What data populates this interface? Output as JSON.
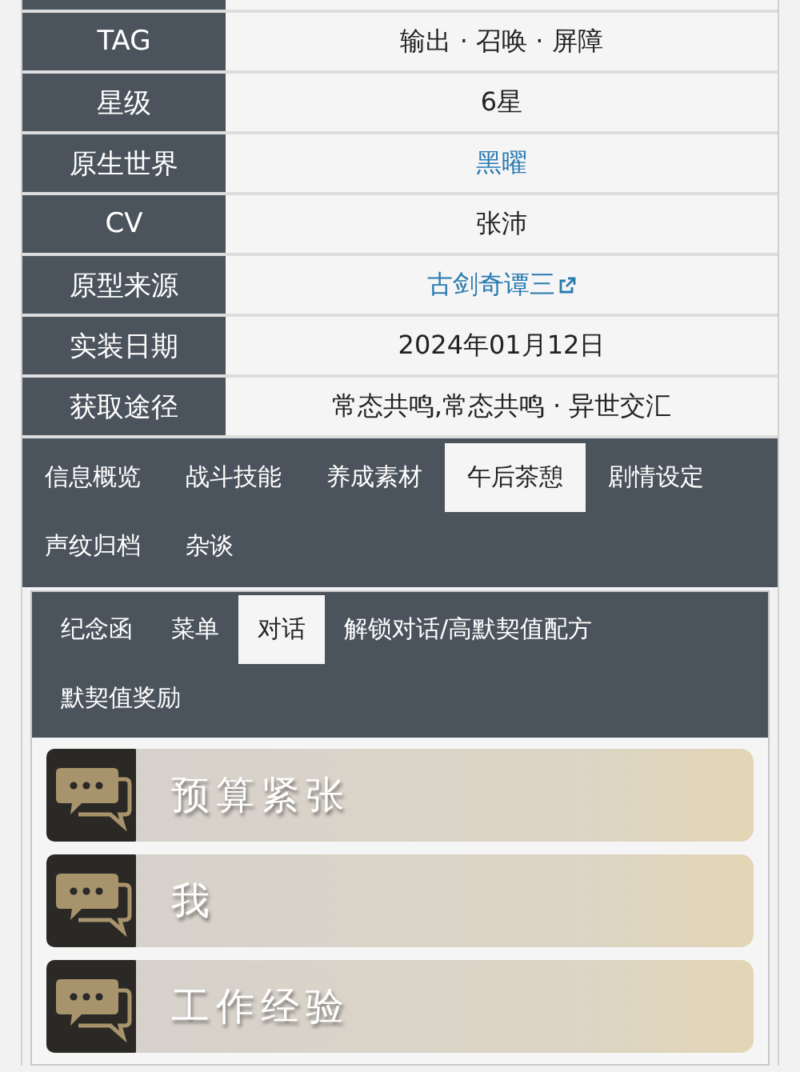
{
  "info_table": {
    "rows": [
      {
        "label": "TAG",
        "value": "输出 · 召唤 · 屏障",
        "kind": "text"
      },
      {
        "label": "星级",
        "value": "6星",
        "kind": "text"
      },
      {
        "label": "原生世界",
        "value": "黑曜",
        "kind": "link"
      },
      {
        "label": "CV",
        "value": "张沛",
        "kind": "text"
      },
      {
        "label": "原型来源",
        "value": "古剑奇谭三",
        "kind": "external_link"
      },
      {
        "label": "实装日期",
        "value": "2024年01月12日",
        "kind": "text"
      },
      {
        "label": "获取途径",
        "value": "常态共鸣,常态共鸣 · 异世交汇",
        "kind": "text"
      }
    ]
  },
  "tabs": [
    {
      "label": "信息概览",
      "selected": false
    },
    {
      "label": "战斗技能",
      "selected": false
    },
    {
      "label": "养成素材",
      "selected": false
    },
    {
      "label": "午后茶憩",
      "selected": true
    },
    {
      "label": "剧情设定",
      "selected": false
    },
    {
      "label": "声纹归档",
      "selected": false
    },
    {
      "label": "杂谈",
      "selected": false
    }
  ],
  "subtabs": [
    {
      "label": "纪念函",
      "selected": false
    },
    {
      "label": "菜单",
      "selected": false
    },
    {
      "label": "对话",
      "selected": true
    },
    {
      "label": "解锁对话/高默契值配方",
      "selected": false
    },
    {
      "label": "默契值奖励",
      "selected": false
    }
  ],
  "dialogues": [
    {
      "title": "预算紧张"
    },
    {
      "title": "我"
    },
    {
      "title": "工作经验"
    }
  ]
}
